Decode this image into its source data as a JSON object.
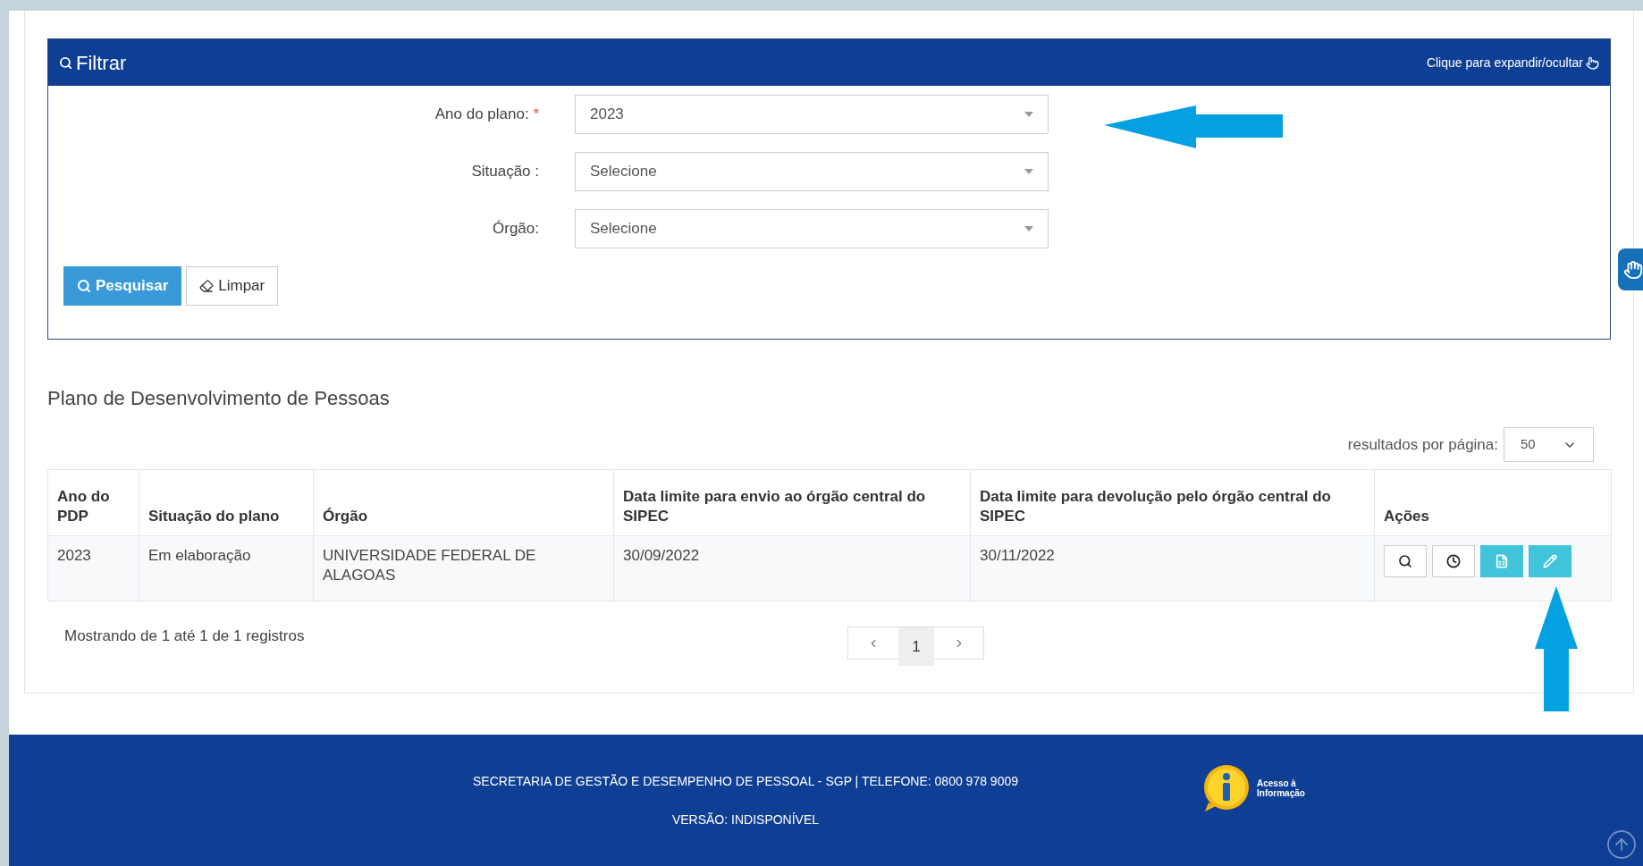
{
  "filter": {
    "title": "Filtrar",
    "toggle_hint": "Clique para expandir/ocultar",
    "fields": [
      {
        "label": "Ano do plano:",
        "marker": "*",
        "value": "2023"
      },
      {
        "label": "Situação :",
        "placeholder": "Selecione"
      },
      {
        "label": "Órgão:",
        "placeholder": "Selecione"
      }
    ],
    "buttons": [
      {
        "kind": "primary",
        "label": "Pesquisar"
      },
      {
        "kind": "default",
        "label": "Limpar"
      }
    ]
  },
  "section_title": "Plano de Desenvolvimento de Pessoas",
  "page_size": {
    "label": "resultados por página:",
    "value": "50"
  },
  "table": {
    "columns": [
      "Ano do PDP",
      "Situação do plano",
      "Órgão",
      "Data limite para envio ao órgão central do SIPEC",
      "Data limite para devolução pelo órgão central do SIPEC",
      "Ações"
    ],
    "rows": [
      {
        "cells": [
          "2023",
          "Em elaboração",
          "UNIVERSIDADE FEDERAL DE ALAGOAS",
          "30/09/2022",
          "30/11/2022"
        ],
        "actions": [
          {
            "kind": "view"
          },
          {
            "kind": "history"
          },
          {
            "kind": "excel"
          },
          {
            "kind": "edit"
          }
        ]
      }
    ]
  },
  "info": "Mostrando de 1 até 1 de 1 registros",
  "pagination": {
    "pages": [
      {
        "label": "1",
        "selected": true
      }
    ]
  },
  "footer": {
    "lines": [
      "SECRETARIA DE GESTÃO E DESEMPENHO DE PESSOAL - SGP | TELEFONE: 0800 978 9009",
      "VERSÃO: INDISPONÍVEL"
    ],
    "logo_text": [
      "Acesso à",
      "Informação"
    ]
  }
}
